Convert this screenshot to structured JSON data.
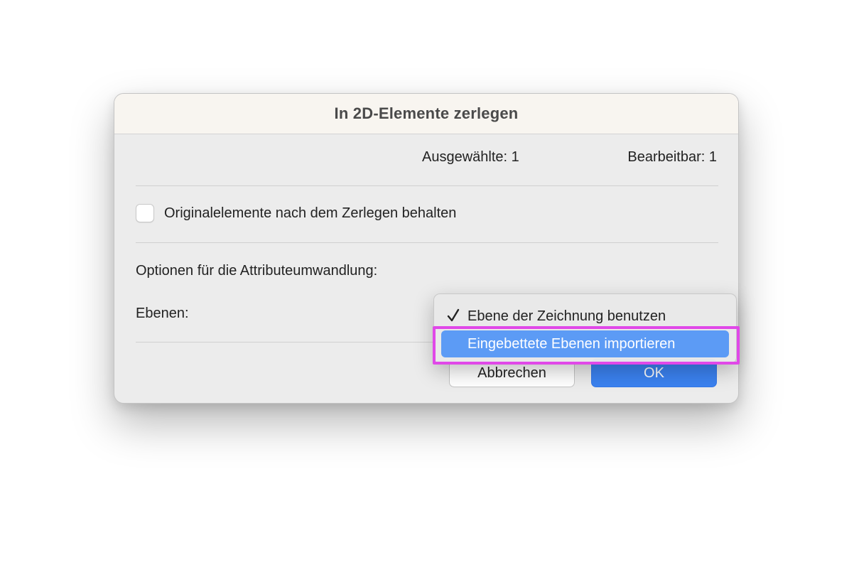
{
  "dialog": {
    "title": "In 2D-Elemente zerlegen",
    "selected_count": "Ausgewählte: 1",
    "editable_count": "Bearbeitbar: 1",
    "keep_originals": {
      "label": "Originalelemente nach dem Zerlegen behalten",
      "checked": false
    },
    "options_label": "Optionen für die Attributeumwandlung:",
    "layers_label": "Ebenen:",
    "cancel_label": "Abbrechen",
    "ok_label": "OK"
  },
  "layers_menu": {
    "items": [
      {
        "label": "Ebene der Zeichnung benutzen",
        "checked": true
      },
      {
        "label": "Eingebettete Ebenen importieren",
        "checked": false,
        "highlighted": true
      }
    ]
  },
  "colors": {
    "accent_blue": "#3b82f0",
    "menu_highlight": "#5c9bf5",
    "annotation_magenta": "#e048e8",
    "titlebar": "#f8f5f0"
  },
  "icons": {
    "checkmark": "checkmark-icon"
  }
}
